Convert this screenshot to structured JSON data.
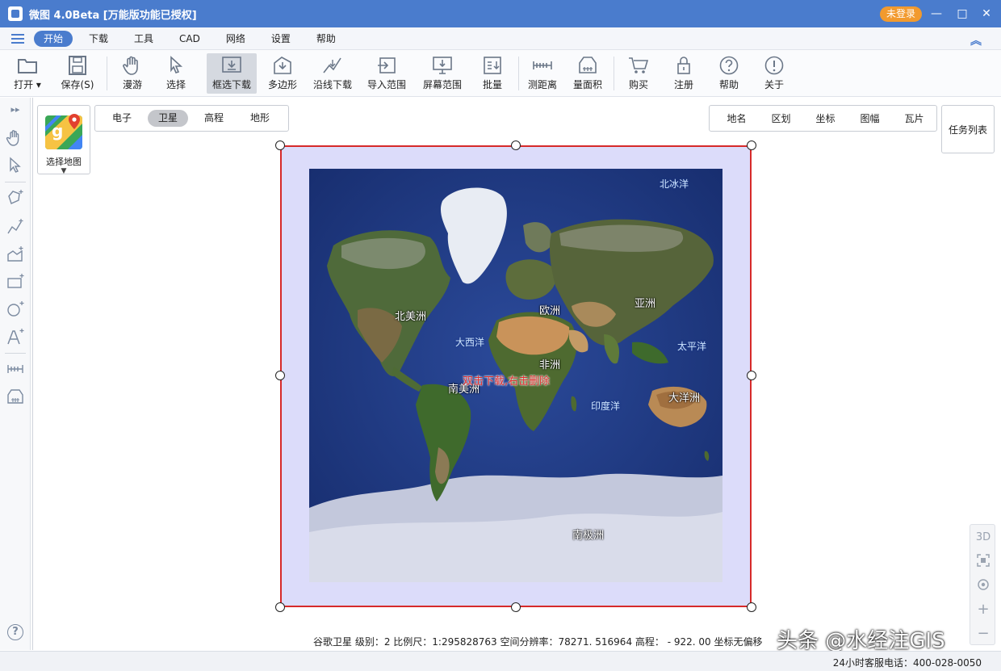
{
  "window": {
    "title": "微图 4.0Beta [万能版功能已授权]",
    "login_label": "未登录",
    "minimize": "—",
    "maximize": "□",
    "close": "✕"
  },
  "menu": {
    "items": [
      "开始",
      "下载",
      "工具",
      "CAD",
      "网络",
      "设置",
      "帮助"
    ],
    "active": "开始"
  },
  "toolbar": {
    "open": "打开",
    "save": "保存(S)",
    "pan": "漫游",
    "select": "选择",
    "box_download": "框选下载",
    "polygon": "多边形",
    "line_download": "沿线下载",
    "import_range": "导入范围",
    "screen_range": "屏幕范围",
    "batch": "批量",
    "measure_distance": "测距离",
    "measure_area": "量面积",
    "buy": "购买",
    "register": "注册",
    "help": "帮助",
    "about": "关于",
    "icons": {
      "open": "folder-icon",
      "save": "floppy-icon",
      "pan": "hand-icon",
      "select": "cursor-icon",
      "box_download": "box-download-icon",
      "polygon": "polygon-icon",
      "line_download": "line-icon",
      "import_range": "import-icon",
      "screen_range": "monitor-icon",
      "batch": "batch-icon",
      "measure_distance": "ruler-icon",
      "measure_area": "area-icon",
      "buy": "cart-icon",
      "register": "lock-icon",
      "help": "question-icon",
      "about": "info-icon"
    }
  },
  "map_panel": {
    "select_map_label": "选择地图",
    "map_types": [
      "电子",
      "卫星",
      "高程",
      "地形"
    ],
    "active_type": "卫星",
    "layers": [
      "地名",
      "区划",
      "坐标",
      "图幅",
      "瓦片"
    ],
    "task_list": "任务列表"
  },
  "map_labels": {
    "north_america": "北美洲",
    "south_america": "南美洲",
    "europe": "欧洲",
    "asia": "亚洲",
    "africa": "非洲",
    "oceania": "大洋洲",
    "antarctica": "南极洲",
    "arctic_ocean": "北冰洋",
    "atlantic_ocean": "大西洋",
    "pacific_ocean": "太平洋",
    "indian_ocean": "印度洋"
  },
  "selection_hint": "双击下载,右击删除",
  "map_controls": {
    "three_d": "3D",
    "zoom_in": "+",
    "zoom_out": "−"
  },
  "status": {
    "text": "谷歌卫星  级别：2   比例尺：1:295828763  空间分辨率：78271. 516964    高程：  - 922. 00  坐标无偏移"
  },
  "watermark": "头条 @水经注GIS",
  "hotline": "24小时客服电话：400-028-0050",
  "help_glyph": "?",
  "colors": {
    "titlebar": "#4a7ccd",
    "login": "#f29a2e",
    "selection_border": "#d62a2a",
    "selection_fill": "#dcdcfa",
    "hint_text": "#e03030"
  }
}
